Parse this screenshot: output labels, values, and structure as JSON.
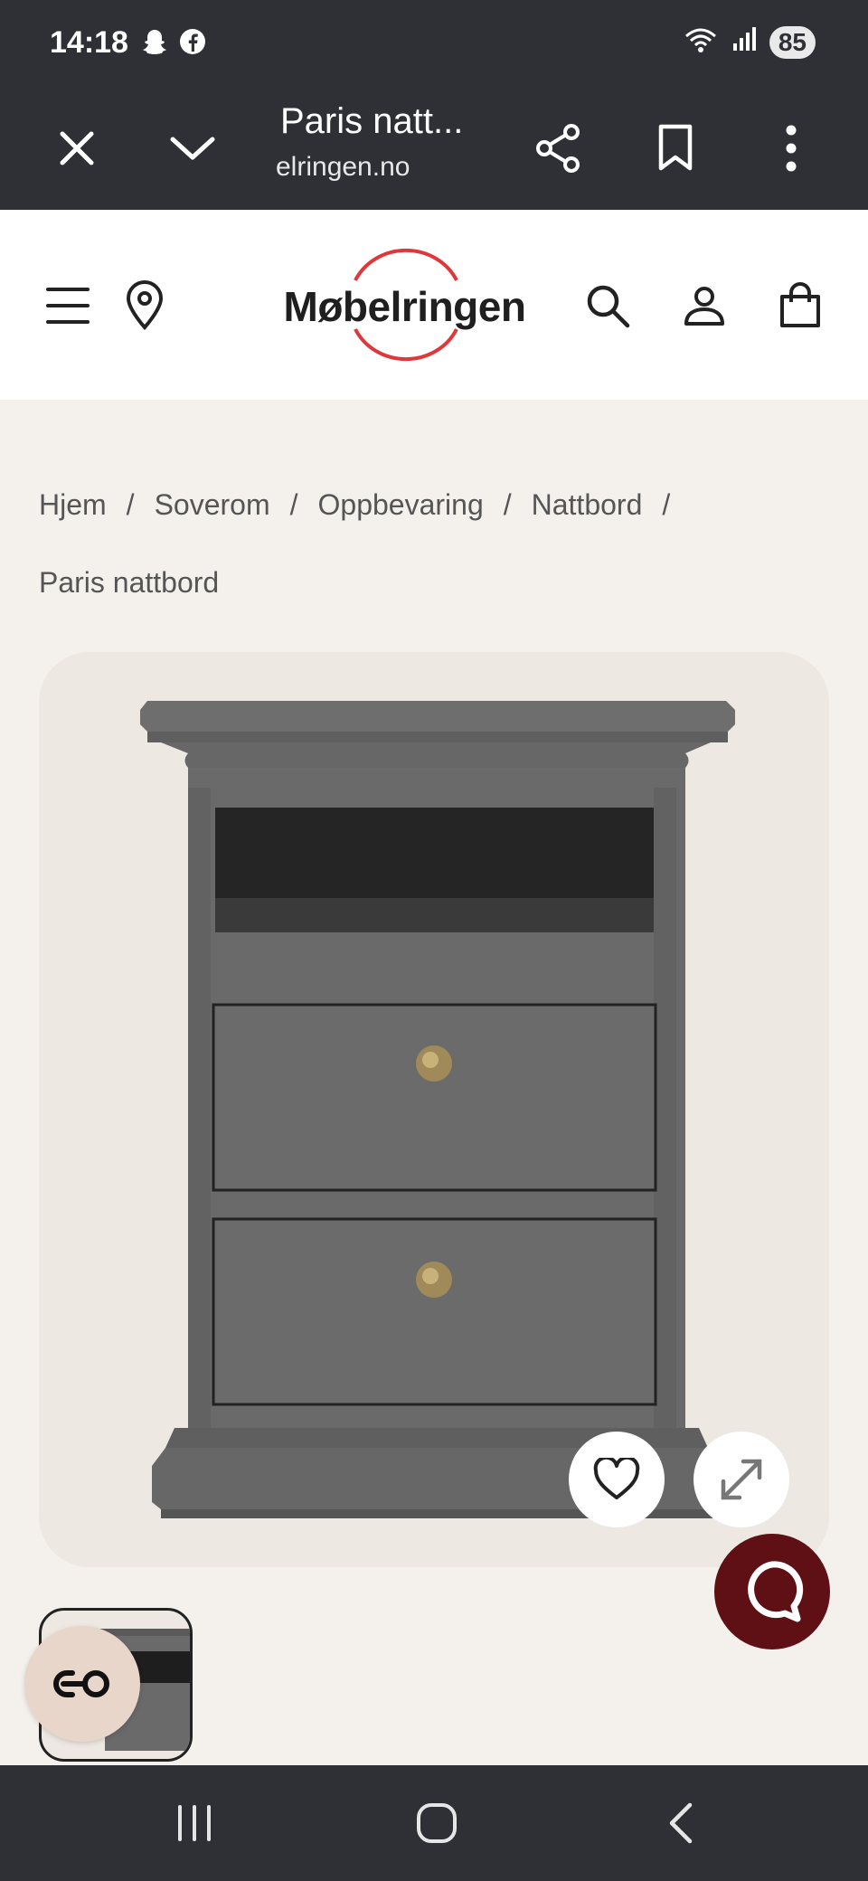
{
  "status_bar": {
    "time": "14:18",
    "battery": "85",
    "left_icons": [
      "snapchat-icon",
      "facebook-icon"
    ],
    "right_icons": [
      "wifi-icon",
      "signal-icon"
    ]
  },
  "browser": {
    "title": "Paris natt...",
    "url": "elringen.no",
    "icons": [
      "close-icon",
      "chevron-down-icon",
      "share-icon",
      "bookmark-icon",
      "more-vert-icon"
    ]
  },
  "header": {
    "logo_text": "Møbelringen",
    "icons": [
      "menu-icon",
      "location-icon",
      "search-icon",
      "user-icon",
      "cart-icon"
    ]
  },
  "breadcrumb": {
    "items": [
      "Hjem",
      "Soverom",
      "Oppbevaring",
      "Nattbord"
    ],
    "separator": "/",
    "current": "Paris nattbord"
  },
  "product_image": {
    "alt_subject": "nightstand-product-image",
    "actions": [
      "heart-icon",
      "expand-icon"
    ]
  },
  "colors": {
    "chrome": "#2e3035",
    "page_bg": "#f4f1ed",
    "card_bg": "#ede8e1",
    "chat_button": "#5e1014",
    "logo_ring": "#e0383a",
    "product_grey": "#6a6a6a"
  },
  "nav_bar": {
    "icons": [
      "recent-apps-icon",
      "home-icon",
      "back-icon"
    ]
  }
}
